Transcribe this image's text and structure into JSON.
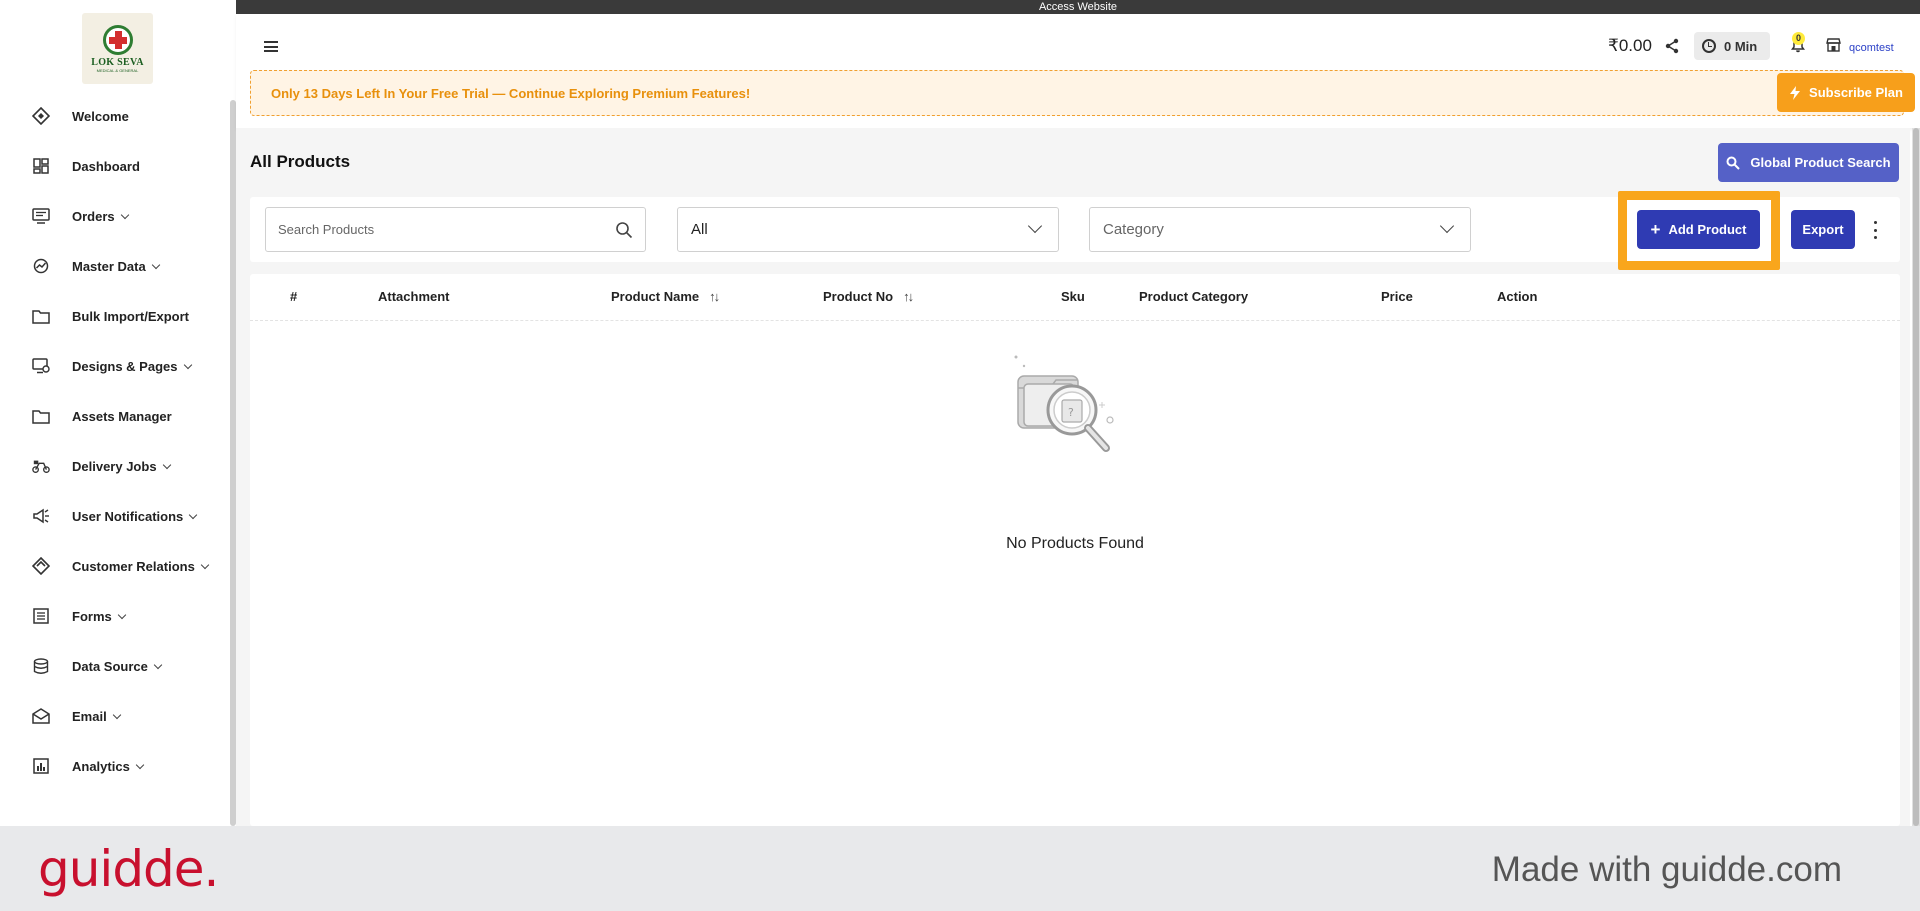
{
  "logo": {
    "line1": "LOK SEVA",
    "line2": "MEDICAL & GENERAL"
  },
  "sidebar": {
    "items": [
      {
        "label": "Welcome",
        "icon": "welcome-icon",
        "has_chevron": false
      },
      {
        "label": "Dashboard",
        "icon": "dashboard-icon",
        "has_chevron": false
      },
      {
        "label": "Orders",
        "icon": "orders-icon",
        "has_chevron": true
      },
      {
        "label": "Master Data",
        "icon": "master-data-icon",
        "has_chevron": true
      },
      {
        "label": "Bulk Import/Export",
        "icon": "folder-icon",
        "has_chevron": false
      },
      {
        "label": "Designs & Pages",
        "icon": "designs-icon",
        "has_chevron": true
      },
      {
        "label": "Assets Manager",
        "icon": "folder-icon",
        "has_chevron": false
      },
      {
        "label": "Delivery Jobs",
        "icon": "delivery-icon",
        "has_chevron": true
      },
      {
        "label": "User Notifications",
        "icon": "megaphone-icon",
        "has_chevron": true
      },
      {
        "label": "Customer Relations",
        "icon": "handshake-icon",
        "has_chevron": true
      },
      {
        "label": "Forms",
        "icon": "forms-icon",
        "has_chevron": true
      },
      {
        "label": "Data Source",
        "icon": "database-icon",
        "has_chevron": true
      },
      {
        "label": "Email",
        "icon": "email-icon",
        "has_chevron": true
      },
      {
        "label": "Analytics",
        "icon": "analytics-icon",
        "has_chevron": true
      }
    ]
  },
  "topbar": {
    "access_label": "Access Website"
  },
  "header": {
    "balance": "₹0.00",
    "timer": "0 Min",
    "notifications_count": "0",
    "store_name": "qcomtest"
  },
  "trial": {
    "message": "Only 13 Days Left In Your Free Trial — Continue Exploring Premium Features!",
    "subscribe_label": "Subscribe Plan"
  },
  "page": {
    "title": "All Products",
    "global_search_label": "Global Product Search"
  },
  "filters": {
    "search_placeholder": "Search Products",
    "status_value": "All",
    "category_placeholder": "Category",
    "add_label": "Add Product",
    "export_label": "Export"
  },
  "table": {
    "columns": [
      "#",
      "Attachment",
      "Product Name",
      "Product No",
      "Sku",
      "Product Category",
      "Price",
      "Action"
    ],
    "sort_glyph": "↑↓",
    "empty_message": "No Products Found"
  },
  "footer": {
    "brand": "guidde.",
    "tagline": "Made with guidde.com"
  },
  "colors": {
    "primary": "#2f3bb3",
    "accent_orange": "#f79f1b",
    "global_search": "#5561c7",
    "guidde_red": "#c8102e"
  }
}
